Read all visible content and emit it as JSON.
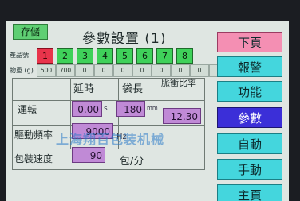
{
  "header": {
    "save_label": "存儲",
    "title": "參數設置 (1)"
  },
  "product": {
    "label": "產品號",
    "numbers": [
      "1",
      "2",
      "3",
      "4",
      "5",
      "6",
      "7",
      "8"
    ],
    "active_index": 0
  },
  "weight": {
    "label": "物重 (g)",
    "values": [
      "500",
      "700",
      "0",
      "0",
      "0",
      "0",
      "0",
      "0",
      "0",
      "0"
    ]
  },
  "table": {
    "headers": {
      "delay": "延時",
      "bag_length": "袋長",
      "pulse_ratio": "脈衝比率"
    },
    "rows": {
      "run": "運転",
      "drive_freq": "驅動頻率",
      "pack_speed": "包裝速度"
    },
    "values": {
      "delay": "0.00",
      "delay_unit": "s",
      "bag_length": "180",
      "bag_length_unit": "mm",
      "pulse_ratio": "12.30",
      "drive_freq": "9000",
      "drive_freq_unit": "Hz",
      "pack_speed": "90",
      "pack_speed_unit": "包/分"
    }
  },
  "sidebar": {
    "items": [
      {
        "label": "下頁"
      },
      {
        "label": "報警"
      },
      {
        "label": "功能"
      },
      {
        "label": "參數"
      },
      {
        "label": "自動"
      },
      {
        "label": "手動"
      },
      {
        "label": "主頁"
      }
    ]
  },
  "watermark": "上海翔百包装机械"
}
